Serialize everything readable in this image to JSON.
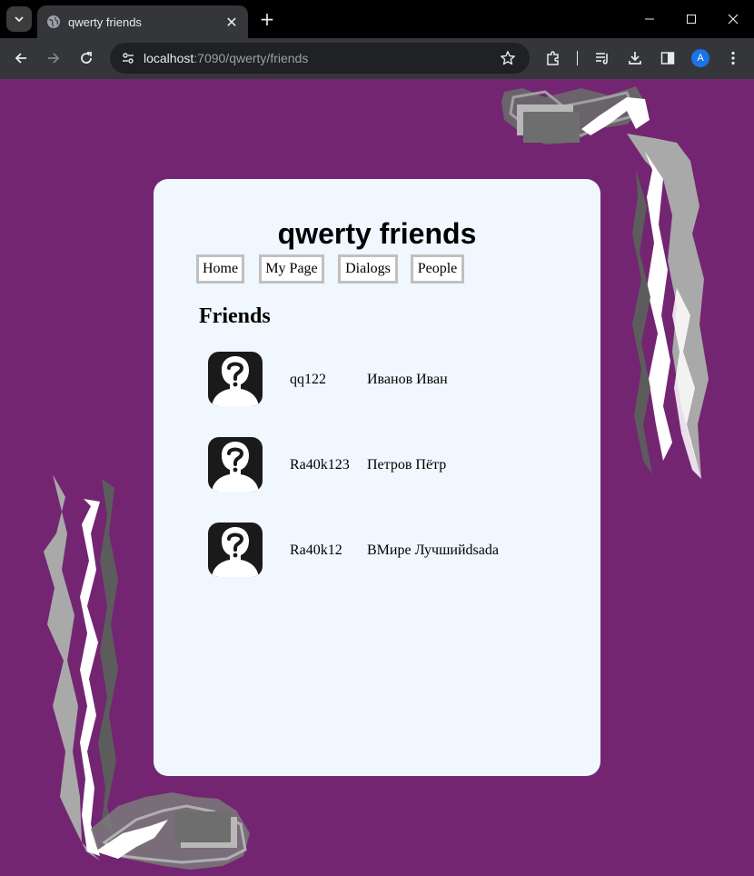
{
  "browser": {
    "tab_title": "qwerty friends",
    "url_host": "localhost",
    "url_path": ":7090/qwerty/friends",
    "profile_initial": "A",
    "tab_list_icon": "chevron-down-icon",
    "close_tab_icon": "close-icon",
    "new_tab_icon": "plus-icon",
    "minimize_glyph": "—",
    "maximize_glyph": "☐",
    "close_glyph": "✕",
    "plus_glyph": "+",
    "tab_close_glyph": "✕",
    "back_glyph": "←",
    "forward_glyph": "→",
    "reload_glyph": "↻",
    "star_glyph": "☆"
  },
  "site": {
    "title": "qwerty friends",
    "nav": [
      {
        "label": "Home"
      },
      {
        "label": "My Page"
      },
      {
        "label": "Dialogs"
      },
      {
        "label": "People"
      }
    ],
    "section_title": "Friends"
  },
  "friends": [
    {
      "login": "qq122",
      "name": "Иванов Иван"
    },
    {
      "login": "Ra40k123",
      "name": "Петров Пётр"
    },
    {
      "login": "Ra40k12",
      "name": "ВМире Лучшийdsada"
    }
  ],
  "colors": {
    "background": "#732572",
    "card": "#f0f7ff",
    "nav_border": "#c0c0c0"
  }
}
